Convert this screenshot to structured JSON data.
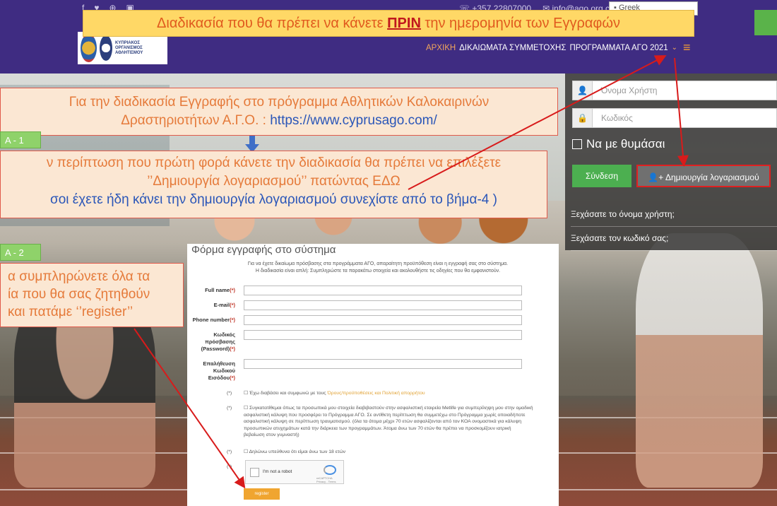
{
  "top": {
    "banner": {
      "before": "Διαδικασία που θα πρέπει να κάνετε ",
      "emph": "ΠΡΙΝ",
      "after": " την ημερομηνία των Εγγραφών"
    },
    "phone": "☏ +357 22807000",
    "email": "✉ info@ago.org.cy",
    "lang": "Greek",
    "social_icons": [
      "facebook-icon",
      "twitter-icon",
      "pinterest-icon",
      "instagram-icon"
    ],
    "logo_text": "ΚΥΠΡΙΑΚΟΣ ΟΡΓΑΝΙΣΜΟΣ ΑΘΛΗΤΙΣΜΟΥ",
    "nav": [
      "ΑΡΧΙΚΗ",
      "ΔΙΚΑΙΩΜΑΤΑ ΣΥΜΜΕΤΟΧΗΣ",
      "ΠΡΟΓΡΑΜΜΑΤΑ ΑΓΟ 2021"
    ],
    "colors": {
      "bar": "#3f2c82",
      "accent": "#f39c34",
      "banner": "#ffd866"
    }
  },
  "login": {
    "username_placeholder": "Όνομα Χρήστη",
    "password_placeholder": "Κωδικός",
    "remember": "Να με θυμάσαι",
    "login_button": "Σύνδεση",
    "create_button": "Δημιουργία λογαριασμού",
    "forgot_username": "Ξεχάσατε το όνομα χρήστη;",
    "forgot_password": "Ξεχάσατε τον κωδικό σας;"
  },
  "notes": {
    "n1_line1": "Για την διαδικασία Εγγραφής στο πρόγραμμα Αθλητικών Καλοκαιρινών",
    "n1_line2a": "Δραστηριοτήτων  Α.Γ.Ο. : ",
    "n1_url": "https://www.cyprusago.com/",
    "step1": "A - 1",
    "n2_line1": "ν περίπτωση που πρώτη φορά κάνετε την διαδικασία θα πρέπει να επιλέξετε",
    "n2_line2": "’’Δημιουργία λογαριασμού’’ πατώντας ΕΔΩ",
    "n2_line3": "σοι έχετε ήδη κάνει την δημιουργία λογαριασμού συνεχίστε από το βήμα-4 )",
    "step2": "A - 2",
    "n3_line1": "α συμπληρώνετε όλα τα",
    "n3_line2": "ία που θα σας ζητηθούν",
    "n3_line3": "και πατάμε ‘’register’’"
  },
  "form": {
    "title": "Φόρμα εγγραφής στο σύστημα",
    "intro1": "Για να έχετε δικαίωμα πρόσβασης στα προγράμματα ΑΓΟ, απαραίτητη προϋπόθεση είναι η εγγραφή σας στο σύστημα.",
    "intro2": "Η διαδικασία είναι απλή: Συμπληρώστε τα παρακάτω στοιχεία και ακολουθήστε τις οδηγίες που θα εμφανιστούν.",
    "fields": {
      "fullname": "Full name",
      "email": "E-mail",
      "phone": "Phone number",
      "password": "Κωδικός πρόσβασης (Password)",
      "confirm": "Επαλήθευση Κωδικού Εισόδου",
      "req": "(*)"
    },
    "terms_before": "Έχω διαβάσει και συμφωνώ με τους ",
    "terms_link": "Όρους/προϋποθέσεις και Πολιτική απορρήτου",
    "insurance": "Συγκατατίθεμαι όπως τα προσωπικά μου στοιχεία διαβιβαστούν στην ασφαλιστική εταιρεία Metlife για συμπερίληψη μου στην ομαδική ασφαλιστική κάλυψη που προσφέρει το Πρόγραμμα ΑΓΟ. Σε αντίθετη περίπτωση θα συμμετέχω στο Πρόγραμμα χωρίς οποιαδήποτε ασφαλιστική κάλυψη σε περίπτωση τραυματισμού. (όλα τα άτομα μέχρι 70 ετών ασφαλίζονται από τον ΚΟΑ ονομαστικά για κάλυψη προσωπικών ατυχημάτων κατά την διάρκεια των προγραμμάτων. Άτομα άνω των 70 ετών θα πρέπει να προσκομίζουν ιατρική βεβαίωση στον γυμναστή)",
    "age": "Δηλώνω υπεύθυνα ότι είμαι άνω των 18 ετών",
    "ast": "(*)",
    "captcha": "I'm not a robot",
    "captcha_brand": "reCAPTCHA",
    "captcha_small": "Privacy - Terms",
    "register": "register"
  }
}
